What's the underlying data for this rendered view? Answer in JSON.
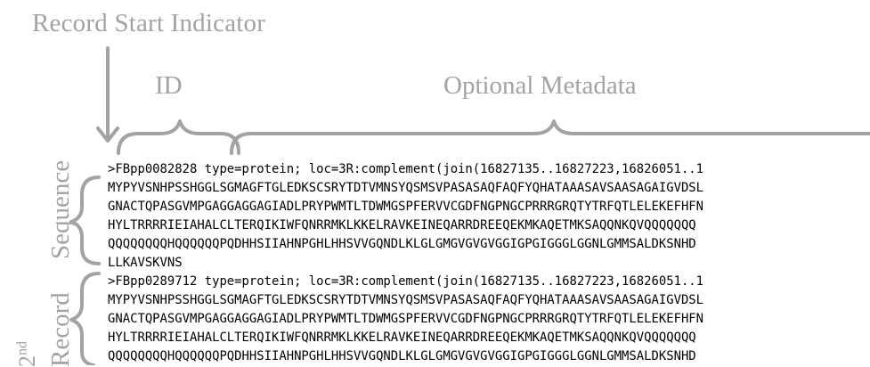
{
  "annotations": {
    "record_start_indicator": "Record Start Indicator",
    "id": "ID",
    "optional_metadata": "Optional Metadata",
    "sequence": "Sequence",
    "second_record_ordinal": "2",
    "second_record_ordinal_suffix": "nd",
    "record": "Record"
  },
  "fasta_lines": [
    ">FBpp0082828 type=protein; loc=3R:complement(join(16827135..16827223,16826051..1",
    "MYPYVSNHPSSHGGLSGMAGFTGLEDKSCSRYTDTVMNSYQSMSVPASASAQFAQFYQHATAAASAVSAASAGAIGVDSL",
    "GNACTQPASGVMPGAGGAGGAGIADLPRYPWMTLTDWMGSPFERVVCGDFNGPNGCPRRRGRQTYTRFQTLELEKEFHFN",
    "HYLTRRRRIEIAHALCLTERQIKIWFQNRRMKLKKELRAVKEINEQARRDREEQEKMKAQETMKSAQQNKQVQQQQQQQ",
    "QQQQQQQQHQQQQQQPQDHHSIIAHNPGHLHHSVVGQNDLKLGLGMGVGVGVGGIGPGIGGGLGGNLGMMSALDKSNHD",
    "LLKAVSKVNS",
    ">FBpp0289712 type=protein; loc=3R:complement(join(16827135..16827223,16826051..1",
    "MYPYVSNHPSSHGGLSGMAGFTGLEDKSCSRYTDTVMNSYQSMSVPASASAQFAQFYQHATAAASAVSAASAGAIGVDSL",
    "GNACTQPASGVMPGAGGAGGAGIADLPRYPWMTLTDWMGSPFERVVCGDFNGPNGCPRRRGRQTYTRFQTLELEKEFHFN",
    "HYLTRRRRIEIAHALCLTERQIKIWFQNRRMKLKKELRAVKEINEQARRDREEQEKMKAQETMKSAQQNKQVQQQQQQQ",
    "QQQQQQQQHQQQQQQPQDHHSIIAHNPGHLHHSVVGQNDLKLGLGMGVGVGVGGIGPGIGGGLGGNLGMMSALDKSNHD"
  ],
  "colors": {
    "annotation": "#a3a3a3",
    "sequence_text": "#000000",
    "background": "#ffffff"
  }
}
